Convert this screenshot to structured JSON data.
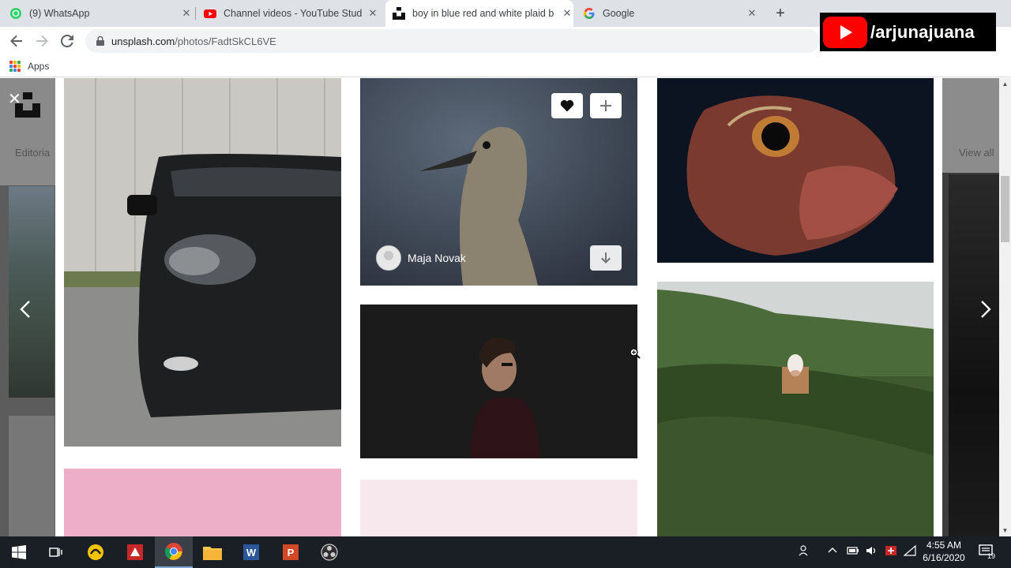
{
  "browser": {
    "tabs": [
      {
        "title": "(9) WhatsApp",
        "icon": "whatsapp-icon",
        "active": false
      },
      {
        "title": "Channel videos - YouTube Studio",
        "icon": "youtube-icon",
        "active": false
      },
      {
        "title": "boy in blue red and white plaid b",
        "icon": "unsplash-icon",
        "active": true
      },
      {
        "title": "Google",
        "icon": "google-icon",
        "active": false
      }
    ],
    "new_tab": "+",
    "url_host": "unsplash.com",
    "url_path": "/photos/FadtSkCL6VE",
    "bookmarks_apps": "Apps"
  },
  "watermark": {
    "channel": "/arjunajuana"
  },
  "background_page": {
    "left_label": "Editoria",
    "right_label": "View all"
  },
  "grid": {
    "featured_photo": {
      "author": "Maja Novak"
    }
  },
  "taskbar": {
    "time": "4:55 AM",
    "date": "6/16/2020",
    "notifications": "19"
  },
  "colors": {
    "tabstrip": "#dee1e6",
    "taskbar": "#1a1f26",
    "youtube_red": "#ff0000",
    "pink_tile": "#edafc8",
    "light_pink_tile": "#f6e8ec"
  }
}
